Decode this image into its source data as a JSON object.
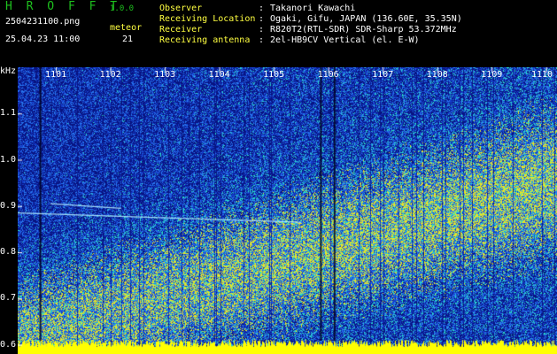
{
  "header": {
    "app_name": "H R O F F T",
    "version": "1.0.0",
    "filename": "2504231100.png",
    "meteor_label": "meteor",
    "datetime": "25.04.23 11:00",
    "meteor_count": "21",
    "fields": [
      {
        "label": "Observer",
        "value": "Takanori Kawachi"
      },
      {
        "label": "Receiving Location",
        "value": "Ogaki, Gifu, JAPAN (136.60E, 35.35N)"
      },
      {
        "label": "Receiver",
        "value": "R820T2(RTL-SDR) SDR-Sharp 53.372MHz"
      },
      {
        "label": "Receiving antenna",
        "value": "2el-HB9CV Vertical (el. E-W)"
      }
    ],
    "separator": ":"
  },
  "chart_data": {
    "type": "heatmap",
    "ylabel": "kHz",
    "yticks": [
      "1.1",
      "1.0",
      "0.9",
      "0.8",
      "0.7",
      "0.6"
    ],
    "ylim": [
      0.58,
      1.2
    ],
    "xticks": [
      "1101",
      "1102",
      "1103",
      "1104",
      "1105",
      "1106",
      "1107",
      "1108",
      "1109",
      "1110"
    ],
    "xlim": [
      1100.3,
      1110.2
    ],
    "meteor_traces": [
      {
        "x": [
          1100.3,
          1105.5
        ],
        "y": [
          0.885,
          0.865
        ]
      },
      {
        "x": [
          1100.9,
          1102.2
        ],
        "y": [
          0.905,
          0.895
        ]
      }
    ],
    "colors": {
      "noise_low": "#0a1a9a",
      "noise_mid": "#2a60e0",
      "signal": "#30e0d0",
      "hot": "#f0f020",
      "baseline": "#ffff00"
    }
  }
}
